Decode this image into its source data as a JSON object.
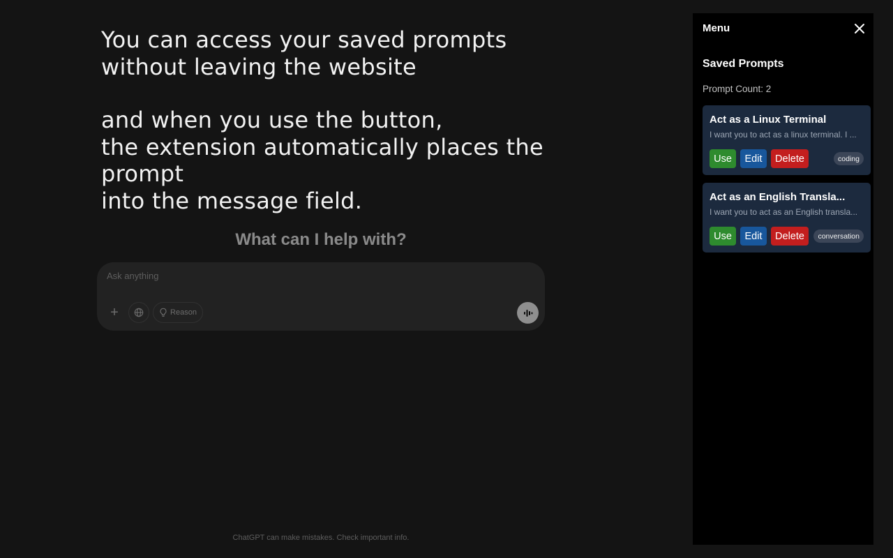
{
  "promo": {
    "line1": "You can access your saved prompts",
    "line2": "without leaving the website",
    "line3": "and when you use the button,",
    "line4": "the extension automatically places the prompt",
    "line5": "into the message field."
  },
  "chat": {
    "headline": "What can I help with?",
    "input_placeholder": "Ask anything",
    "reason_label": "Reason",
    "disclaimer": "ChatGPT can make mistakes. Check important info.",
    "icons": [
      "plus-icon",
      "globe-icon",
      "lightbulb-icon",
      "voice-icon"
    ]
  },
  "sidebar": {
    "title": "Menu",
    "section_title": "Saved Prompts",
    "count_label": "Prompt Count: 2",
    "prompts": [
      {
        "title": "Act as a Linux Terminal",
        "description": "I want you to act as a linux terminal. I ...",
        "use_label": "Use",
        "edit_label": "Edit",
        "delete_label": "Delete",
        "tag": "coding"
      },
      {
        "title": "Act as an English Transla...",
        "description": "I want you to act as an English transla...",
        "use_label": "Use",
        "edit_label": "Edit",
        "delete_label": "Delete",
        "tag": "conversation"
      }
    ]
  },
  "colors": {
    "page_bg": "#141414",
    "sidebar_bg": "#000000",
    "card_bg": "#1c2a3e",
    "use": "#2e8b2e",
    "edit": "#18579c",
    "delete": "#c31e1e",
    "tag_bg": "#3c4658"
  }
}
